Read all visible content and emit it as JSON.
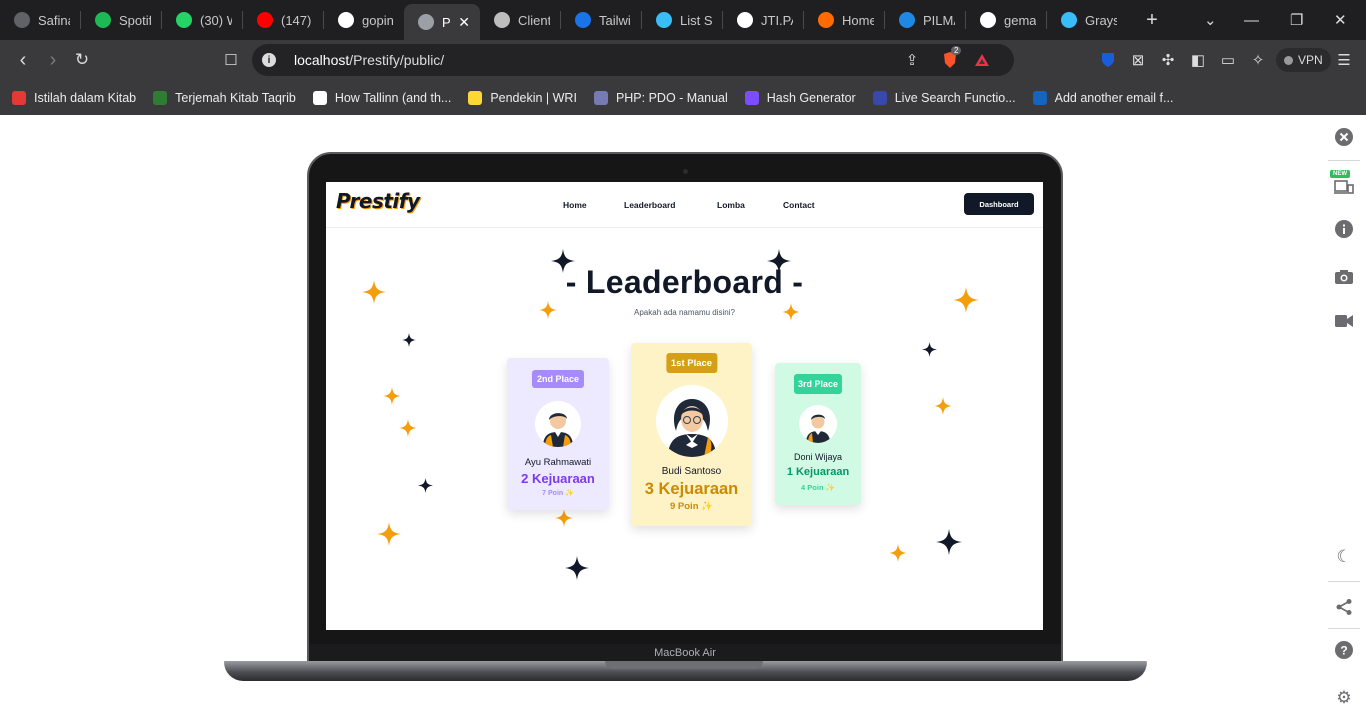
{
  "browser": {
    "tabs": [
      {
        "label": "Safina",
        "icon": "globe-icon",
        "color": "#5f6368"
      },
      {
        "label": "Spotif",
        "icon": "spotify-icon",
        "color": "#1db954"
      },
      {
        "label": "(30) W",
        "icon": "whatsapp-icon",
        "color": "#25d366"
      },
      {
        "label": "(147)",
        "icon": "youtube-icon",
        "color": "#ff0000"
      },
      {
        "label": "gopin",
        "icon": "github-icon",
        "color": "#ffffff"
      },
      {
        "label": "P",
        "icon": "globe-icon",
        "color": "#9aa0a6",
        "active": true
      },
      {
        "label": "Client",
        "icon": "openai-icon",
        "color": "#bdbdbd"
      },
      {
        "label": "Tailwi",
        "icon": "tailwind-icon",
        "color": "#1a73e8"
      },
      {
        "label": "List St",
        "icon": "tailwind-icon",
        "color": "#38bdf8"
      },
      {
        "label": "JTI.PA",
        "icon": "github-icon",
        "color": "#ffffff"
      },
      {
        "label": "Home",
        "icon": "home-icon",
        "color": "#ff6b00"
      },
      {
        "label": "PILMA",
        "icon": "pilmapres-icon",
        "color": "#1e88e5"
      },
      {
        "label": "gema",
        "icon": "google-icon",
        "color": "#ffffff"
      },
      {
        "label": "Grays",
        "icon": "tailwind-icon",
        "color": "#38bdf8"
      }
    ],
    "url": {
      "host": "localhost",
      "path": "/Prestify/public/"
    },
    "brave_count": "2",
    "vpn_label": "VPN",
    "bookmarks": [
      {
        "label": "Istilah dalam Kitab",
        "icon": "bookmark-red-icon",
        "color": "#e53935"
      },
      {
        "label": "Terjemah Kitab Taqrib",
        "icon": "book-icon",
        "color": "#2e7d32"
      },
      {
        "label": "How Tallinn (and th...",
        "icon": "medium-icon",
        "color": "#ffffff"
      },
      {
        "label": "Pendekin | WRI",
        "icon": "lemon-icon",
        "color": "#fdd835"
      },
      {
        "label": "PHP: PDO - Manual",
        "icon": "php-icon",
        "color": "#777bb3"
      },
      {
        "label": "Hash Generator",
        "icon": "hash-icon",
        "color": "#7c4dff"
      },
      {
        "label": "Live Search Functio...",
        "icon": "cloud-icon",
        "color": "#3949ab"
      },
      {
        "label": "Add another email f...",
        "icon": "webflow-icon",
        "color": "#1565c0"
      }
    ]
  },
  "device": {
    "label": "MacBook Air"
  },
  "site": {
    "logo": "Prestify",
    "nav": [
      "Home",
      "Leaderboard",
      "Lomba",
      "Contact"
    ],
    "dashboard_label": "Dashboard",
    "title": "- Leaderboard -",
    "subtitle": "Apakah ada namamu disini?",
    "podium": [
      {
        "place": "2nd Place",
        "name": "Ayu Rahmawati",
        "wins": "2 Kejuaraan",
        "points": "7 Poin ✨",
        "card_color": "#ede9fe",
        "badge_color": "#a78bfa",
        "accent": "#7c3aed",
        "points_color": "#a78bfa"
      },
      {
        "place": "1st Place",
        "name": "Budi Santoso",
        "wins": "3 Kejuaraan",
        "points": "9 Poin ✨",
        "card_color": "#fef3c7",
        "badge_color": "#d4a017",
        "accent": "#ca8a04",
        "points_color": "#ca8a04"
      },
      {
        "place": "3rd Place",
        "name": "Doni Wijaya",
        "wins": "1 Kejuaraan",
        "points": "4 Poin ✨",
        "card_color": "#d1fae5",
        "badge_color": "#34d399",
        "accent": "#059669",
        "points_color": "#34d399"
      }
    ]
  },
  "colors": {
    "sparkle_orange": "#f59e0b",
    "sparkle_navy": "#111827"
  }
}
